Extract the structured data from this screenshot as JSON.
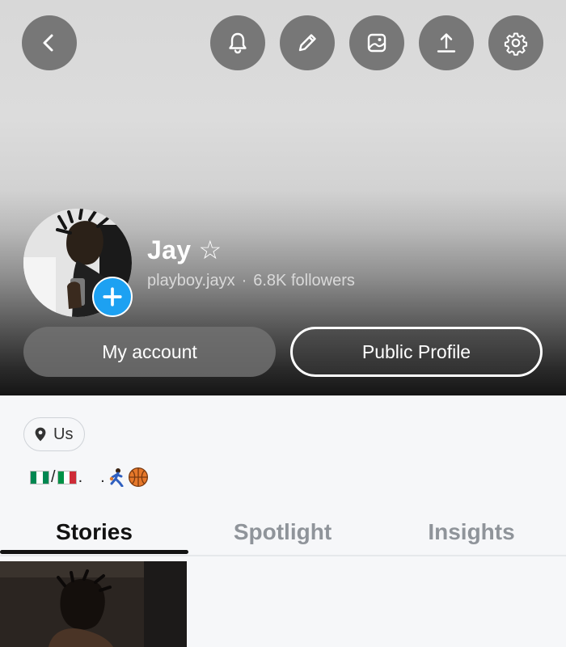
{
  "header": {
    "buttons": [
      {
        "name": "back",
        "icon": "chevron-left-icon"
      },
      {
        "name": "notifications",
        "icon": "bell-icon"
      },
      {
        "name": "edit",
        "icon": "pencil-icon"
      },
      {
        "name": "wallpaper",
        "icon": "image-icon"
      },
      {
        "name": "share",
        "icon": "upload-icon"
      },
      {
        "name": "settings",
        "icon": "gear-icon"
      }
    ]
  },
  "profile": {
    "display_name": "Jay ☆",
    "username": "playboy.jayx",
    "separator": "·",
    "followers": "6.8K followers",
    "add_icon": "plus-icon"
  },
  "actions": {
    "my_account": "My account",
    "public_profile": "Public Profile"
  },
  "location": {
    "icon": "location-pin-icon",
    "label": "Us"
  },
  "bio": {
    "slash": "/",
    "dot": ".",
    "trailing": ".",
    "emojis": [
      "nigeria-flag",
      "italy-flag",
      "basketball-player",
      "basketball"
    ]
  },
  "tabs": [
    {
      "label": "Stories",
      "active": true
    },
    {
      "label": "Spotlight",
      "active": false
    },
    {
      "label": "Insights",
      "active": false
    }
  ],
  "colors": {
    "accent": "#1da1f2",
    "tab_active": "#121212",
    "tab_inactive": "#8f949a"
  }
}
